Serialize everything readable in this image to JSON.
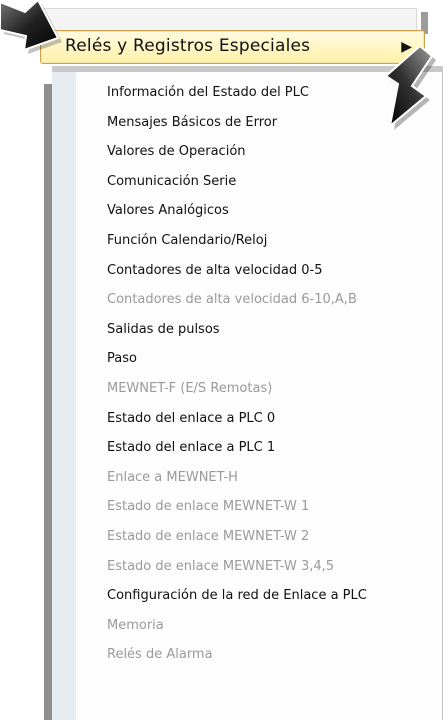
{
  "menu": {
    "parent_label": "Relés y Registros Especiales",
    "chevron": "▶",
    "items": [
      {
        "label": "Información del Estado del PLC",
        "enabled": true
      },
      {
        "label": "Mensajes Básicos de Error",
        "enabled": true
      },
      {
        "label": "Valores de Operación",
        "enabled": true
      },
      {
        "label": "Comunicación Serie",
        "enabled": true
      },
      {
        "label": "Valores Analógicos",
        "enabled": true
      },
      {
        "label": "Función Calendario/Reloj",
        "enabled": true
      },
      {
        "label": "Contadores de alta velocidad 0-5",
        "enabled": true
      },
      {
        "label": "Contadores de alta velocidad 6-10,A,B",
        "enabled": false
      },
      {
        "label": "Salidas de pulsos",
        "enabled": true
      },
      {
        "label": "Paso",
        "enabled": true
      },
      {
        "label": "MEWNET-F (E/S Remotas)",
        "enabled": false
      },
      {
        "label": "Estado del enlace a PLC 0",
        "enabled": true
      },
      {
        "label": "Estado del enlace a PLC 1",
        "enabled": true
      },
      {
        "label": "Enlace a MEWNET-H",
        "enabled": false
      },
      {
        "label": "Estado de enlace MEWNET-W 1",
        "enabled": false
      },
      {
        "label": "Estado de enlace MEWNET-W 2",
        "enabled": false
      },
      {
        "label": "Estado de enlace MEWNET-W 3,4,5",
        "enabled": false
      },
      {
        "label": "Configuración de la red de Enlace a PLC",
        "enabled": true
      },
      {
        "label": "Memoria",
        "enabled": false
      },
      {
        "label": "Relés de Alarma",
        "enabled": false
      }
    ]
  },
  "icons": {
    "left_arrow": "pointer-arrow-icon",
    "right_arrow": "pointer-arrow-icon"
  },
  "colors": {
    "highlight_fill": "#fff0a8",
    "highlight_border": "#c9a24b",
    "disabled_text": "#9a9a9a",
    "gutter": "#e7ebf2"
  }
}
